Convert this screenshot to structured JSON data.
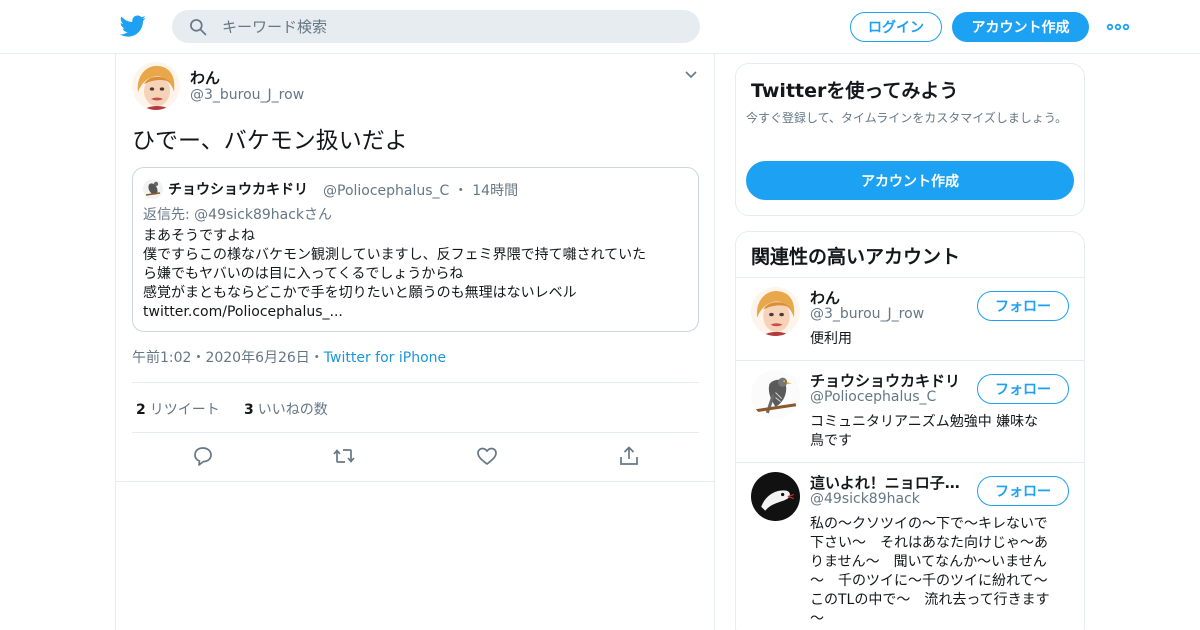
{
  "header": {
    "search_placeholder": "キーワード検索",
    "login_label": "ログイン",
    "signup_label": "アカウント作成"
  },
  "tweet": {
    "author_name": "わん",
    "author_handle": "@3_burou_J_row",
    "text": "ひでー、バケモン扱いだよ",
    "quote": {
      "name": "チョウショウカキドリ",
      "handle": "@Poliocephalus_C",
      "time": "14時間",
      "reply_to": "返信先: @49sick89hackさん",
      "lines": [
        "まあそうですよね",
        "僕ですらこの様なバケモン観測していますし、反フェミ界隈で持て囃されていた",
        "ら嫌でもヤバいのは目に入ってくるでしょうからね",
        "感覚がまともならどこかで手を切りたいと願うのも無理はないレベル",
        "twitter.com/Poliocephalus_..."
      ]
    },
    "timestamp": "午前1:02・2020年6月26日・",
    "source": "Twitter for iPhone",
    "retweet_count": "2",
    "retweet_label": "リツイート",
    "like_count": "3",
    "like_label": "いいねの数"
  },
  "sidebar": {
    "signup_title": "Twitterを使ってみよう",
    "signup_desc": "今すぐ登録して、タイムラインをカスタマイズしましょう。",
    "signup_button": "アカウント作成",
    "related_title": "関連性の高いアカウント",
    "follow_label": "フォロー",
    "accounts": [
      {
        "name": "わん",
        "handle": "@3_burou_J_row",
        "bio_lines": [
          "便利用"
        ]
      },
      {
        "name": "チョウショウカキドリ",
        "handle": "@Poliocephalus_C",
        "bio_lines": [
          "コミュニタリアニズム勉強中 嫌味な",
          "鳥です"
        ]
      },
      {
        "name": "這いよれ！ニョロ子…",
        "handle": "@49sick89hack",
        "bio_lines": [
          "私の～クソツイの～下で～キレないで",
          "下さい～　それはあなた向けじゃ～あ",
          "りません～　聞いてなんか～いません",
          "～　千のツイに～千のツイに紛れて～",
          "このTLの中で～　流れ去って行きます",
          "～"
        ]
      }
    ]
  },
  "colors": {
    "brand": "#1da1f2",
    "text": "#14171a",
    "muted": "#657786",
    "border": "#e6ecf0"
  }
}
